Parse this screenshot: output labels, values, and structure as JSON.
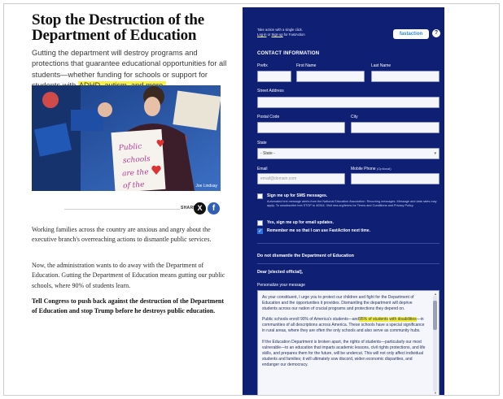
{
  "article": {
    "headline": "Stop the Destruction of the Department of Education",
    "subhead_main": "Gutting the department will destroy programs and protections that guarantee educational opportunities for all students—whether funding for schools or support for students with",
    "subhead_highlight": "ADHD, autism, and more.",
    "photo": {
      "credit": "Joe Lindsay",
      "sign_text": "Public schools are the heart of the"
    },
    "share": {
      "label": "SHARE",
      "x_label": "X",
      "fb_label": "f"
    },
    "paragraphs": [
      "Working families across the country are anxious and angry about the executive branch's overreaching actions to dismantle public services.",
      "Now, the administration wants to do away with the Department of Education. Gutting the Department of Education means gutting our public schools, where 90% of students learn.",
      "Tell Congress to push back against the destruction of the Department of Education and stop Trump before he destroys public education."
    ]
  },
  "form": {
    "top_note_line1": "Take action with a single click.",
    "login_link": "Log in",
    "or_text": "or",
    "signup_link": "Sign up",
    "for_text": "for FastAction",
    "badge": "fastaction",
    "help_symbol": "?",
    "section_title": "CONTACT INFORMATION",
    "labels": {
      "prefix": "Prefix",
      "first_name": "First Name",
      "last_name": "Last Name",
      "street": "Street Address",
      "postal": "Postal Code",
      "city": "City",
      "state": "State",
      "email": "Email",
      "mobile": "Mobile Phone",
      "mobile_opt": "(Optional)"
    },
    "state_value": "- State -",
    "email_placeholder": "email@domain.com",
    "sms": {
      "title": "Sign me up for SMS messages.",
      "note": "Automated text message alerts from the National Education Association. Recurring messages. Message and data rates may apply. To unsubscribe text STOP to 40344. Visit nea.org/terms for Terms and Conditions and Privacy Policy."
    },
    "email_updates": "Yes, sign me up for email updates.",
    "remember": "Remember me so that I can use FastAction next time.",
    "subject": "Do not dismantle the Department of Education",
    "dear": "Dear [elected official],",
    "personalize_label": "Personalize your message",
    "message": {
      "p1": "As your constituent, I urge you to protect our children and fight for the Department of Education and the opportunities it provides. Dismantling the department will deprive students across our nation of crucial programs and protections they depend on.",
      "p2_a": "Public schools enroll 90% of America's students—and",
      "p2_hl1": "95% of students",
      "p2_hl2": "with disabilities",
      "p2_b": "—in communities of all descriptions across America. These schools have a special significance in rural areas, where they are often the only schools and also serve as community hubs.",
      "p3": "If the Education Department is broken apart, the rights of students—particularly our most vulnerable—to an education that imparts academic lessons, civil rights protections, and life skills, and prepares them for the future, will be undercut. This will not only affect individual students and families; it will ultimately sow discord, widen economic disparities, and endanger our democracy."
    }
  },
  "colors": {
    "form_bg": "#0e1f74",
    "highlight": "#f7ef4a",
    "accent_blue": "#2f5fb8"
  }
}
